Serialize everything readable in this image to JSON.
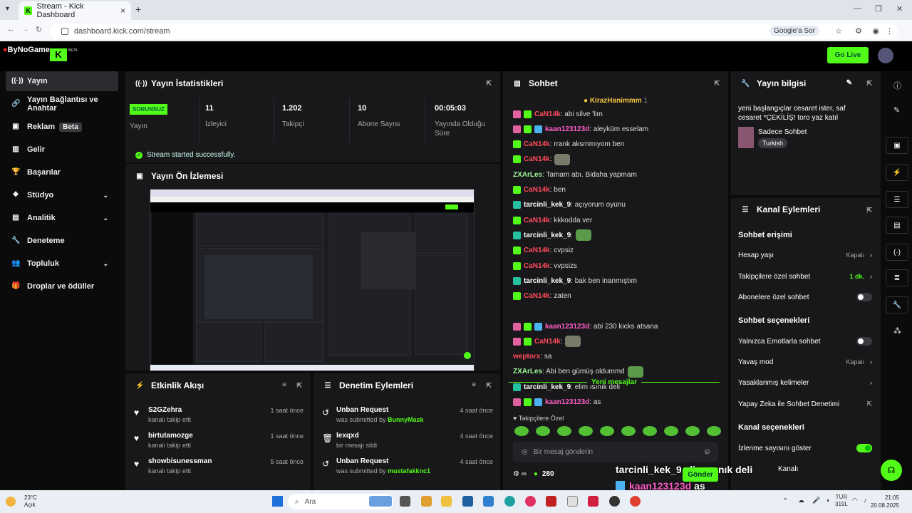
{
  "browser": {
    "tab_title": "Stream - Kick Dashboard",
    "url": "dashboard.kick.com/stream",
    "google_btn": "Google'a Sor"
  },
  "top": {
    "brand": "ByNoGame",
    "beta": "BETA",
    "go_live": "Go Live"
  },
  "sidebar": {
    "items": [
      {
        "label": "Yayın",
        "icon": "broadcast-icon"
      },
      {
        "label": "Yayın Bağlantısı ve Anahtar",
        "icon": "link-icon"
      },
      {
        "label": "Reklam",
        "badge": "Beta",
        "icon": "ad-icon"
      },
      {
        "label": "Gelir",
        "icon": "chart-icon"
      },
      {
        "label": "Başarılar",
        "icon": "trophy-icon"
      },
      {
        "label": "Stüdyo",
        "icon": "layers-icon",
        "chevron": true
      },
      {
        "label": "Analitik",
        "icon": "analytics-icon",
        "chevron": true
      },
      {
        "label": "Deneteme",
        "icon": "wrench-icon"
      },
      {
        "label": "Topluluk",
        "icon": "users-icon",
        "chevron": true
      },
      {
        "label": "Droplar ve ödüller",
        "icon": "gift-icon"
      }
    ]
  },
  "stats": {
    "title": "Yayın İstatistikleri",
    "status_badge": "SORUNSUZ",
    "status_label": "Yayın",
    "items": [
      {
        "value": "11",
        "label": "İzleyici"
      },
      {
        "value": "1.202",
        "label": "Takipçi"
      },
      {
        "value": "10",
        "label": "Abone Sayısı"
      },
      {
        "value": "00:05:03",
        "label": "Yayında Olduğu Süre"
      }
    ],
    "message": "Stream started successfully."
  },
  "preview": {
    "title": "Yayın Ön İzlemesi"
  },
  "activity": {
    "title": "Etkinlik Akışı",
    "items": [
      {
        "name": "S2GZehra",
        "sub": "kanalı takip etti",
        "time": "1 saat önce"
      },
      {
        "name": "birtutamozge",
        "sub": "kanalı takip etti",
        "time": "1 saat önce"
      },
      {
        "name": "showbisunessman",
        "sub": "kanalı takip etti",
        "time": "5 saat önce"
      }
    ]
  },
  "moderation": {
    "title": "Denetim Eylemleri",
    "items": [
      {
        "name": "Unban Request",
        "sub": "was submitted by ",
        "who": "BunnyMask",
        "time": "4 saat önce"
      },
      {
        "name": "lexqxd",
        "sub": "bir mesajı sildi",
        "who": "",
        "time": "4 saat önce"
      },
      {
        "name": "Unban Request",
        "sub": "was submitted by ",
        "who": "mustafakknc1",
        "time": "4 saat önce"
      }
    ]
  },
  "chat": {
    "title": "Sohbet",
    "pinned_user": "KirazHanimmm",
    "pinned_count": "1",
    "lines": [
      {
        "user": "CaN14k",
        "text": ": abi silve 'lim",
        "color": "red",
        "badges": [
          "pink",
          "grn"
        ]
      },
      {
        "user": "kaan123123d",
        "text": ": aleyküm esselam",
        "color": "pink",
        "badges": [
          "pink",
          "grn",
          "blu"
        ]
      },
      {
        "user": "CaN14k",
        "text": ": rrank aksmmıyom ben",
        "color": "red",
        "badges": [
          "grn"
        ]
      },
      {
        "user": "CaN14k",
        "text": ":",
        "color": "red",
        "badges": [
          "grn"
        ],
        "emote": true
      },
      {
        "user": "ZXArLes",
        "text": ": Tamam abı. Bidaha yapmam",
        "color": "lg",
        "badges": []
      },
      {
        "user": "CaN14k",
        "text": ": ben",
        "color": "red",
        "badges": [
          "grn"
        ]
      },
      {
        "user": "tarcinli_kek_9",
        "text": ": açıyorum oyunu",
        "color": "wht",
        "badges": [
          "teal"
        ]
      },
      {
        "user": "CaN14k",
        "text": ": kkkodda ver",
        "color": "red",
        "badges": [
          "grn"
        ]
      },
      {
        "user": "tarcinli_kek_9",
        "text": ":",
        "color": "wht",
        "badges": [
          "teal"
        ],
        "frog": true
      },
      {
        "user": "CaN14k",
        "text": ": cvpsiz",
        "color": "red",
        "badges": [
          "grn"
        ]
      },
      {
        "user": "CaN14k",
        "text": ": vvpsizs",
        "color": "red",
        "badges": [
          "grn"
        ]
      },
      {
        "user": "tarcinli_kek_9",
        "text": ": bak ben inanmıştım",
        "color": "wht",
        "badges": [
          "teal"
        ]
      },
      {
        "user": "CaN14k",
        "text": ": zaten",
        "color": "red",
        "badges": [
          "grn"
        ]
      }
    ],
    "new_label": "Yeni mesajlar",
    "lines2": [
      {
        "user": "kaan123123d",
        "text": ": abi 230 kicks atsana",
        "color": "pink",
        "badges": [
          "pink",
          "grn",
          "blu"
        ]
      },
      {
        "user": "CaN14k",
        "text": ":",
        "color": "red",
        "badges": [
          "pink",
          "grn"
        ],
        "emote": true
      },
      {
        "user": "weptorx",
        "text": ": sa",
        "color": "red",
        "badges": []
      },
      {
        "user": "ZXArLes",
        "text": ": Abi ben gümüş oldummd",
        "color": "lg",
        "badges": [],
        "frog": true
      },
      {
        "user": "tarcinli_kek_9",
        "text": ": elim ısınık deli",
        "color": "wht",
        "badges": [
          "teal"
        ]
      },
      {
        "user": "kaan123123d",
        "text": ": as",
        "color": "pink",
        "badges": [
          "pink",
          "grn",
          "blu"
        ]
      }
    ],
    "followers_only": "Takipçilere Özel",
    "input_placeholder": "Bir mesaj gönderin",
    "count": "280",
    "send": "Gönder"
  },
  "info": {
    "title": "Yayın bilgisi",
    "text": "yeni başlangıçlar cesaret ister, saf cesaret *ÇEKİLİŞ! toro yaz katıl",
    "category": "Sadece Sohbet",
    "tag": "Turkish"
  },
  "channel": {
    "title": "Kanal Eylemleri",
    "access_title": "Sohbet erişimi",
    "age": "Hesap yaşı",
    "age_val": "Kapalı",
    "followers": "Takipçilere özel sohbet",
    "followers_val": "1 dk.",
    "subs": "Abonelere özel sohbet",
    "opts_title": "Sohbet seçenekleri",
    "emotes": "Yalnızca Emotlarla sohbet",
    "slow": "Yavaş mod",
    "slow_val": "Kapalı",
    "banned": "Yasaklanmış kelimeler",
    "ai": "Yapay Zeka ile Sohbet Denetimi",
    "chan_title": "Kanal seçenekleri",
    "viewers": "İzlenme sayısını göster",
    "kanal": "Kanalı"
  },
  "overlay": {
    "line1": "tarcinli_kek_9 elim ısınık deli",
    "user2": "kaan123123d",
    "text2": "as"
  },
  "taskbar": {
    "temp": "23°C",
    "weather": "Açık",
    "search": "Ara",
    "lang": "TUR",
    "lang2": "319L",
    "time": "21:05",
    "date": "20.08.2025"
  }
}
